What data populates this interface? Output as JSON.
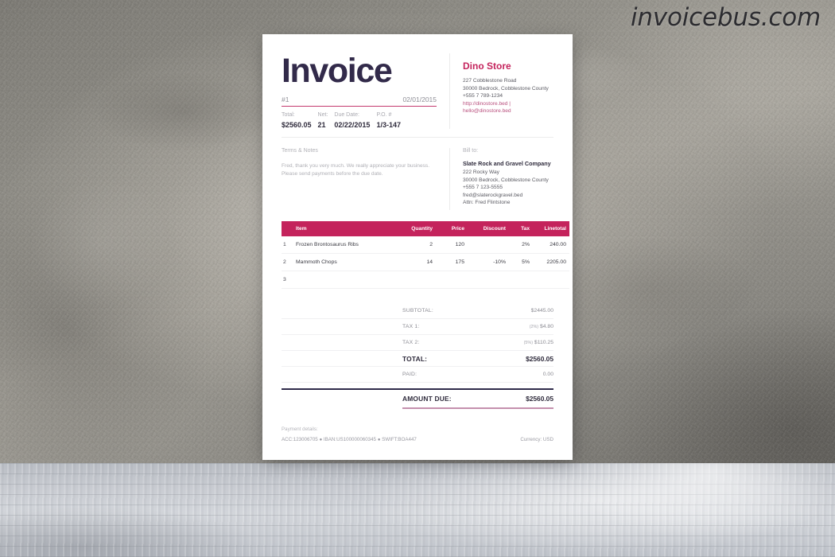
{
  "watermark": "invoicebus.com",
  "invoice": {
    "title": "Invoice",
    "number": "#1",
    "date": "02/01/2015",
    "meta": [
      {
        "label": "Total:",
        "value": "$2560.05"
      },
      {
        "label": "Net:",
        "value": "21"
      },
      {
        "label": "Due Date:",
        "value": "02/22/2015"
      },
      {
        "label": "P.O. #",
        "value": "1/3-147"
      }
    ]
  },
  "company": {
    "name": "Dino Store",
    "lines": [
      "227 Cobblestone Road",
      "30000 Bedrock, Cobblestone County",
      "+555 7 789-1234"
    ],
    "website": "http://dinostore.bed |",
    "email": "hello@dinostore.bed"
  },
  "terms": {
    "label": "Terms & Notes",
    "body_line1": "Fred, thank you very much. We really appreciate your business.",
    "body_line2": "Please send payments before the due date."
  },
  "bill_to": {
    "label": "Bill to:",
    "name": "Slate Rock and Gravel Company",
    "lines": [
      "222 Rocky Way",
      "30000 Bedrock, Cobblestone County",
      "+555 7 123-5555",
      "fred@slaterockgravel.bed",
      "Attn: Fred Flintstone"
    ]
  },
  "table": {
    "headers": {
      "item": "Item",
      "quantity": "Quantity",
      "price": "Price",
      "discount": "Discount",
      "tax": "Tax",
      "linetotal": "Linetotal"
    },
    "rows": [
      {
        "idx": "1",
        "item": "Frozen Brontosaurus Ribs",
        "quantity": "2",
        "price": "120",
        "discount": "",
        "tax": "2%",
        "linetotal": "240.00"
      },
      {
        "idx": "2",
        "item": "Mammoth Chops",
        "quantity": "14",
        "price": "175",
        "discount": "-10%",
        "tax": "5%",
        "linetotal": "2205.00"
      },
      {
        "idx": "3",
        "item": "",
        "quantity": "",
        "price": "",
        "discount": "",
        "tax": "",
        "linetotal": ""
      }
    ]
  },
  "totals": {
    "subtotal_label": "SUBTOTAL:",
    "subtotal_value": "$2445.00",
    "tax1_label": "TAX 1:",
    "tax1_pct": "(2%)",
    "tax1_value": "$4.80",
    "tax2_label": "TAX 2:",
    "tax2_pct": "(5%)",
    "tax2_value": "$110.25",
    "total_label": "TOTAL:",
    "total_value": "$2560.05",
    "paid_label": "PAID:",
    "paid_value": "0.00",
    "amount_due_label": "AMOUNT DUE:",
    "amount_due_value": "$2560.05"
  },
  "footer": {
    "payment_label": "Payment details:",
    "payment_line": "ACC:123006705 ● IBAN:US100000060345 ● SWIFT:BOA447",
    "currency": "Currency: USD"
  },
  "colors": {
    "accent_pink": "#c4235c",
    "title_navy": "#322a4a",
    "rule_pink": "#c4396e",
    "due_underline": "#c490ad"
  }
}
